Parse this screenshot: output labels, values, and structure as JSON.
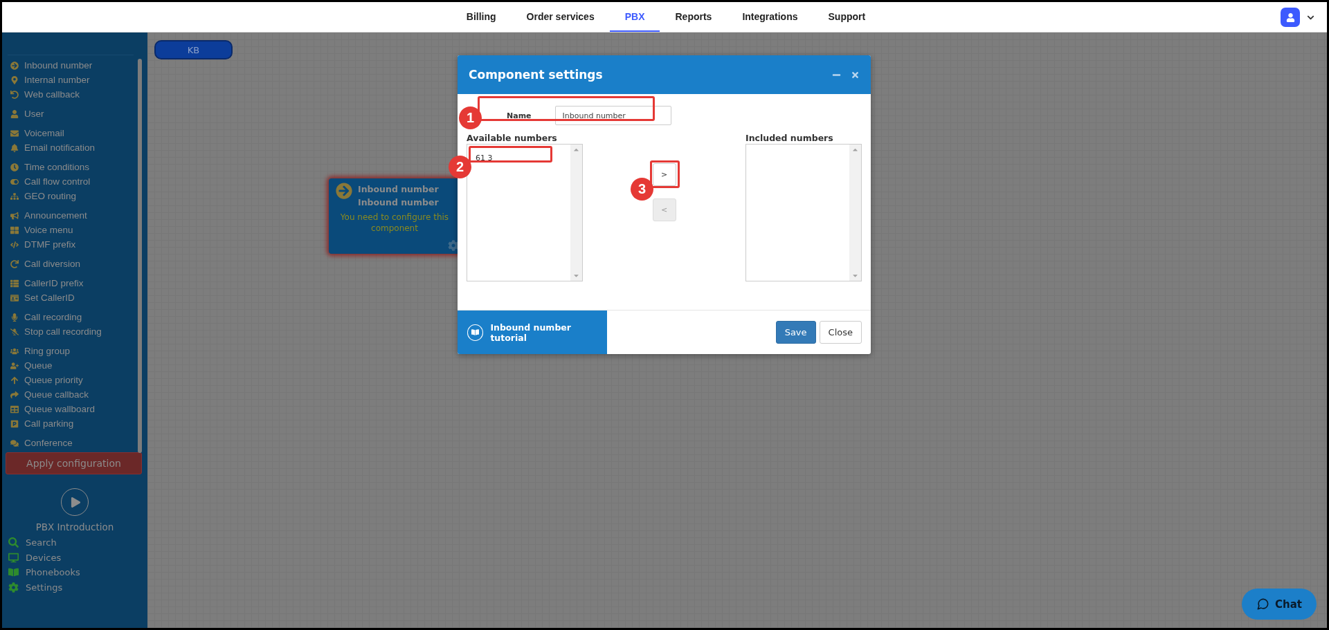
{
  "top_nav": {
    "tabs": [
      {
        "label": "Billing",
        "selected": false
      },
      {
        "label": "Order services",
        "selected": false
      },
      {
        "label": "PBX",
        "selected": true
      },
      {
        "label": "Reports",
        "selected": false
      },
      {
        "label": "Integrations",
        "selected": false
      },
      {
        "label": "Support",
        "selected": false
      }
    ]
  },
  "sidebar": {
    "groups": [
      {
        "items": [
          {
            "label": "Inbound number"
          },
          {
            "label": "Internal number"
          },
          {
            "label": "Web callback"
          }
        ]
      },
      {
        "items": [
          {
            "label": "User"
          }
        ]
      },
      {
        "items": [
          {
            "label": "Voicemail"
          },
          {
            "label": "Email notification"
          }
        ]
      },
      {
        "items": [
          {
            "label": "Time conditions"
          },
          {
            "label": "Call flow control"
          },
          {
            "label": "GEO routing"
          }
        ]
      },
      {
        "items": [
          {
            "label": "Announcement"
          },
          {
            "label": "Voice menu"
          },
          {
            "label": "DTMF prefix"
          }
        ]
      },
      {
        "items": [
          {
            "label": "Call diversion"
          }
        ]
      },
      {
        "items": [
          {
            "label": "CallerID prefix"
          },
          {
            "label": "Set CallerID"
          }
        ]
      },
      {
        "items": [
          {
            "label": "Call recording"
          },
          {
            "label": "Stop call recording"
          }
        ]
      },
      {
        "items": [
          {
            "label": "Ring group"
          },
          {
            "label": "Queue"
          },
          {
            "label": "Queue priority"
          },
          {
            "label": "Queue callback"
          },
          {
            "label": "Queue wallboard"
          },
          {
            "label": "Call parking"
          }
        ]
      },
      {
        "items": [
          {
            "label": "Conference"
          }
        ]
      }
    ],
    "apply_button": "Apply configuration",
    "intro": "PBX Introduction",
    "tools": [
      {
        "label": "Search"
      },
      {
        "label": "Devices"
      },
      {
        "label": "Phonebooks"
      },
      {
        "label": "Settings"
      }
    ]
  },
  "canvas": {
    "kb_button": "KB",
    "node": {
      "title": "Inbound number",
      "subtitle": "Inbound number",
      "warning": "You need to configure this component"
    }
  },
  "dialog": {
    "title": "Component settings",
    "name_label": "Name",
    "name_value": "Inbound number",
    "available": {
      "label": "Available numbers",
      "options": [
        {
          "label": "61 3"
        }
      ]
    },
    "included": {
      "label": "Included numbers"
    },
    "move_buttons": [
      {
        "label": ">",
        "disabled": false
      },
      {
        "label": "<",
        "disabled": true
      }
    ],
    "tutorial": "Inbound number tutorial",
    "buttons": [
      "Save",
      "Close"
    ]
  },
  "annotations": [
    {
      "number": "1"
    },
    {
      "number": "2"
    },
    {
      "number": "3"
    }
  ],
  "chat": "Chat"
}
